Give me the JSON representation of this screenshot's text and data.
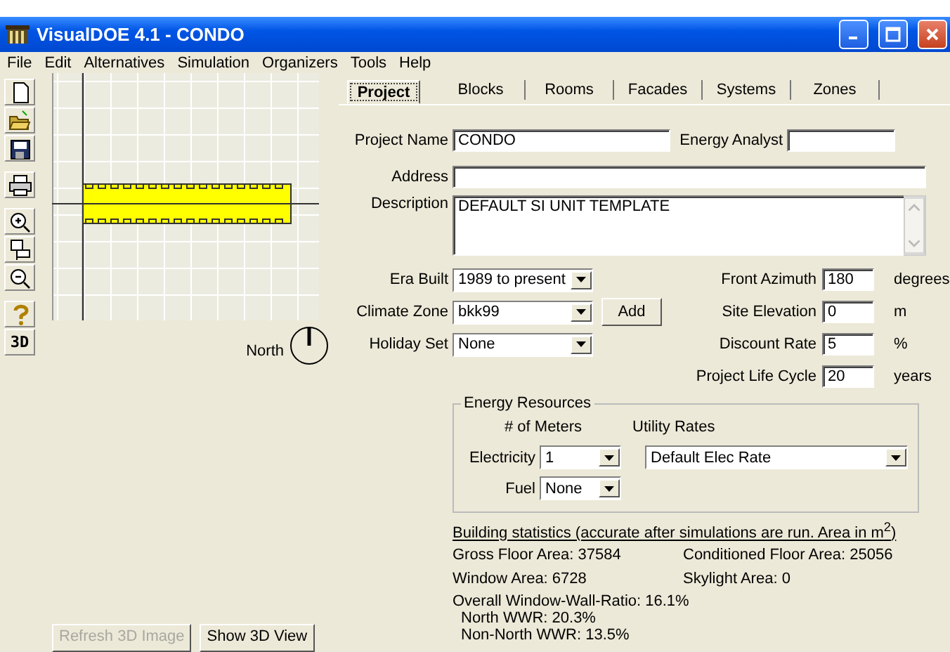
{
  "window": {
    "title": "VisualDOE 4.1 - CONDO"
  },
  "menu": [
    "File",
    "Edit",
    "Alternatives",
    "Simulation",
    "Organizers",
    "Tools",
    "Help"
  ],
  "toolbar": {
    "view_3d_label": "3D"
  },
  "plan": {
    "compass_label": "North"
  },
  "view_buttons": [
    {
      "label": "Refresh 3D Image",
      "disabled": true
    },
    {
      "label": "Show 3D View",
      "disabled": false
    }
  ],
  "tabs": [
    {
      "label": "Project",
      "selected": true
    },
    {
      "label": "Blocks",
      "selected": false
    },
    {
      "label": "Rooms",
      "selected": false
    },
    {
      "label": "Facades",
      "selected": false
    },
    {
      "label": "Systems",
      "selected": false
    },
    {
      "label": "Zones",
      "selected": false
    }
  ],
  "project_name": {
    "label": "Project Name",
    "value": "CONDO"
  },
  "energy_analyst": {
    "label": "Energy Analyst"
  },
  "address": {
    "label": "Address"
  },
  "description": {
    "label": "Description",
    "value": "DEFAULT SI UNIT TEMPLATE"
  },
  "left_fields": [
    {
      "label": "Era Built",
      "value": "1989 to present"
    },
    {
      "label": "Climate Zone",
      "value": "bkk99",
      "button": "Add"
    },
    {
      "label": "Holiday Set",
      "value": "None"
    }
  ],
  "right_fields": [
    {
      "label": "Front Azimuth",
      "value": "180",
      "unit": "degrees"
    },
    {
      "label": "Site Elevation",
      "value": "0",
      "unit": "m"
    },
    {
      "label": "Discount Rate",
      "value": "5",
      "unit": "%"
    },
    {
      "label": "Project Life Cycle",
      "value": "20",
      "unit": "years"
    }
  ],
  "energy_resources": {
    "title": "Energy Resources",
    "meters_heading": "# of Meters",
    "rates_heading": "Utility Rates",
    "rows": [
      {
        "label": "Electricity",
        "meters": "1",
        "rate": "Default Elec Rate"
      },
      {
        "label": "Fuel",
        "meters": "None"
      }
    ]
  },
  "statistics": {
    "heading": "Building statistics (accurate after simulations are run. Area in m$^{2}$)",
    "pairs": [
      [
        "Gross Floor Area: 37584",
        "Conditioned Floor Area: 25056"
      ],
      [
        "Window Area: 6728",
        "Skylight Area: 0"
      ]
    ],
    "ratios": [
      {
        "text": "Overall Window-Wall-Ratio: 16.1%",
        "indent": false
      },
      {
        "text": "North WWR: 20.3%",
        "indent": true
      },
      {
        "text": "Non-North WWR: 13.5%",
        "indent": true
      }
    ]
  }
}
